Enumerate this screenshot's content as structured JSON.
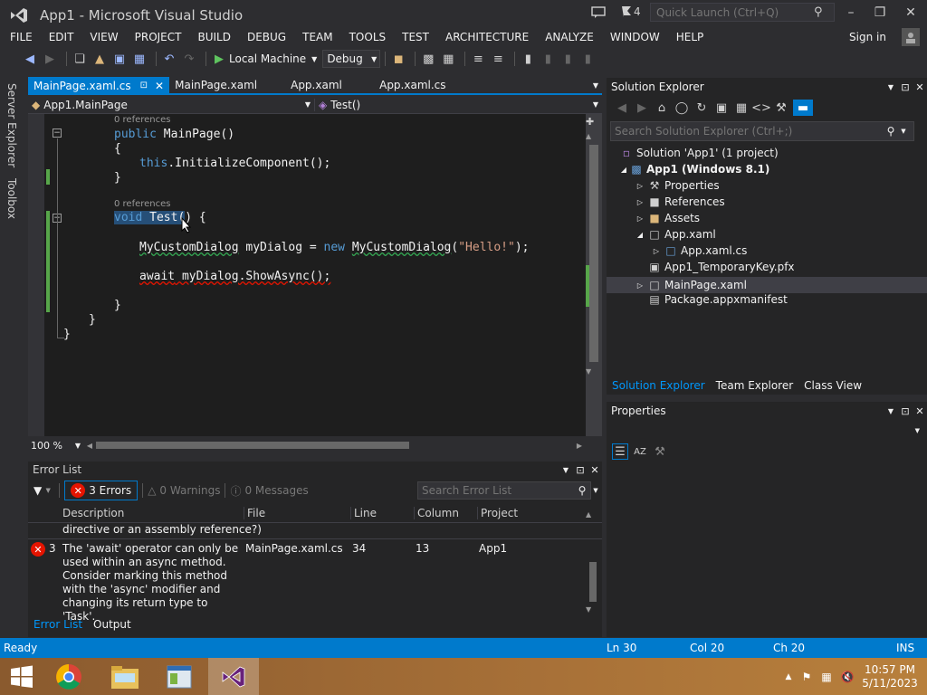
{
  "window": {
    "title": "App1 - Microsoft Visual Studio",
    "notification_count": "4",
    "quick_launch_placeholder": "Quick Launch (Ctrl+Q)"
  },
  "menu": [
    "FILE",
    "EDIT",
    "VIEW",
    "PROJECT",
    "BUILD",
    "DEBUG",
    "TEAM",
    "TOOLS",
    "TEST",
    "ARCHITECTURE",
    "ANALYZE",
    "WINDOW",
    "HELP"
  ],
  "account": {
    "signin": "Sign in"
  },
  "toolbar": {
    "run_label": "Local Machine",
    "config": "Debug"
  },
  "side_tabs": [
    "Server Explorer",
    "Toolbox"
  ],
  "tabs": [
    {
      "label": "MainPage.xaml.cs",
      "active": true
    },
    {
      "label": "MainPage.xaml"
    },
    {
      "label": "App.xaml"
    },
    {
      "label": "App.xaml.cs"
    }
  ],
  "navbar": {
    "class": "App1.MainPage",
    "member": "Test()"
  },
  "code": {
    "ref0": "0 references",
    "l1a": "public",
    "l1b": " MainPage()",
    "l2": "{",
    "l3a": "this",
    "l3b": ".InitializeComponent();",
    "l4": "}",
    "ref1": "0 references",
    "l5a": "void",
    "l5b": " Test(",
    "l5c": ")",
    "l5d": " {",
    "l6a": "MyCustomDialog",
    "l6b": " myDialog = ",
    "l6c": "new",
    "l6d": " ",
    "l6e": "MyCustomDialog",
    "l6f": "(",
    "l6g": "\"Hello!\"",
    "l6h": ");",
    "l7a": "await",
    "l7b": " myDialog.ShowAsync();",
    "l8": "}",
    "l9": "}",
    "l10": "}"
  },
  "zoom": "100 %",
  "error_list": {
    "title": "Error List",
    "errors": "3 Errors",
    "warnings": "0 Warnings",
    "messages": "0 Messages",
    "search_placeholder": "Search Error List",
    "columns": [
      "Description",
      "File",
      "Line",
      "Column",
      "Project"
    ],
    "prev_row_tail": "directive or an assembly reference?)",
    "row": {
      "num": "3",
      "description": "The 'await' operator can only be used within an async method. Consider marking this method with the 'async' modifier and changing its return type to 'Task'.",
      "file": "MainPage.xaml.cs",
      "line": "34",
      "column": "13",
      "project": "App1"
    },
    "bottom_tabs": [
      "Error List",
      "Output"
    ]
  },
  "solution_explorer": {
    "title": "Solution Explorer",
    "search_placeholder": "Search Solution Explorer (Ctrl+;)",
    "items": [
      "Solution 'App1' (1 project)",
      "App1 (Windows 8.1)",
      "Properties",
      "References",
      "Assets",
      "App.xaml",
      "App.xaml.cs",
      "App1_TemporaryKey.pfx",
      "MainPage.xaml",
      "Package.appxmanifest"
    ],
    "tabs": [
      "Solution Explorer",
      "Team Explorer",
      "Class View"
    ]
  },
  "properties": {
    "title": "Properties"
  },
  "status": {
    "ready": "Ready",
    "ln": "Ln 30",
    "col": "Col 20",
    "ch": "Ch 20",
    "mode": "INS"
  },
  "clock": {
    "time": "10:57 PM",
    "date": "5/11/2023"
  }
}
